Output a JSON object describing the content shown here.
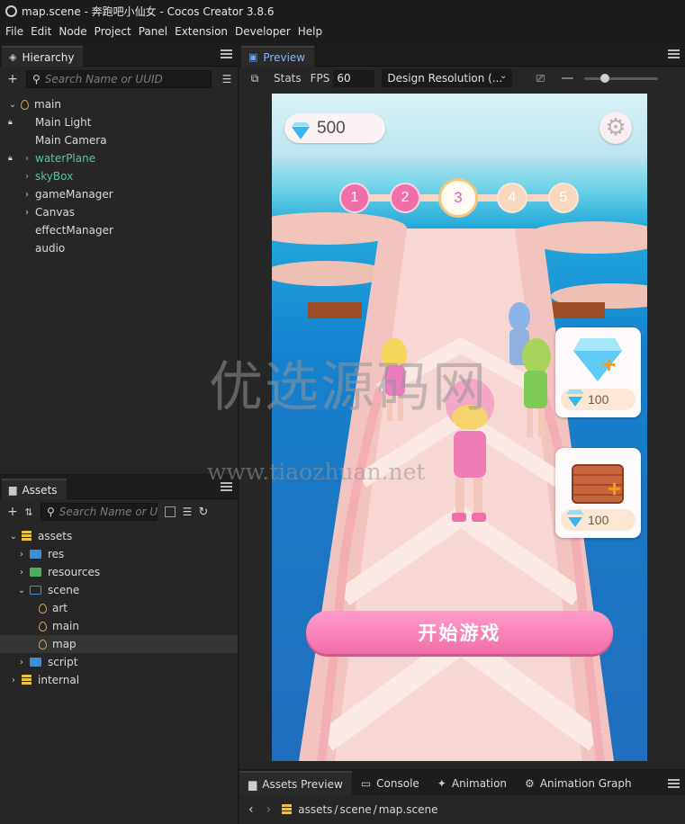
{
  "window": {
    "title": "map.scene - 奔跑吧小仙女 - Cocos Creator 3.8.6"
  },
  "menu": [
    "File",
    "Edit",
    "Node",
    "Project",
    "Panel",
    "Extension",
    "Developer",
    "Help"
  ],
  "hierarchy": {
    "tab_label": "Hierarchy",
    "search_placeholder": "Search Name or UUID",
    "items": [
      {
        "label": "main"
      },
      {
        "label": "Main Light"
      },
      {
        "label": "Main Camera"
      },
      {
        "label": "waterPlane"
      },
      {
        "label": "skyBox"
      },
      {
        "label": "gameManager"
      },
      {
        "label": "Canvas"
      },
      {
        "label": "effectManager"
      },
      {
        "label": "audio"
      }
    ]
  },
  "assets": {
    "tab_label": "Assets",
    "search_placeholder": "Search Name or UUID",
    "items": [
      {
        "label": "assets"
      },
      {
        "label": "res"
      },
      {
        "label": "resources"
      },
      {
        "label": "scene"
      },
      {
        "label": "art"
      },
      {
        "label": "main"
      },
      {
        "label": "map"
      },
      {
        "label": "script"
      },
      {
        "label": "internal"
      }
    ]
  },
  "preview": {
    "tab_label": "Preview",
    "stats_label": "Stats",
    "fps_label": "FPS",
    "fps_value": "60",
    "resolution_label": "Design Resolution (...",
    "zoom_level": 0.25
  },
  "game": {
    "gem_count": "500",
    "levels": [
      {
        "label": "1",
        "state": "done"
      },
      {
        "label": "2",
        "state": "done"
      },
      {
        "label": "3",
        "state": "current"
      },
      {
        "label": "4",
        "state": "locked"
      },
      {
        "label": "5",
        "state": "locked"
      }
    ],
    "shop": [
      {
        "price": "100",
        "item_icon": "diamond-icon"
      },
      {
        "price": "100",
        "item_icon": "crate-icon"
      }
    ],
    "start_button_label": "开始游戏",
    "watermark_text": "优选源码网",
    "watermark_url": "www.tiaozhuan.net"
  },
  "bottom": {
    "tabs": [
      "Assets Preview",
      "Console",
      "Animation",
      "Animation Graph"
    ],
    "path": [
      "assets",
      "scene",
      "map.scene"
    ],
    "path_separator": "/"
  },
  "colors": {
    "accent_green": "#54c79f",
    "start_button": "#f26ea8",
    "level_done": "#f06fa8"
  }
}
